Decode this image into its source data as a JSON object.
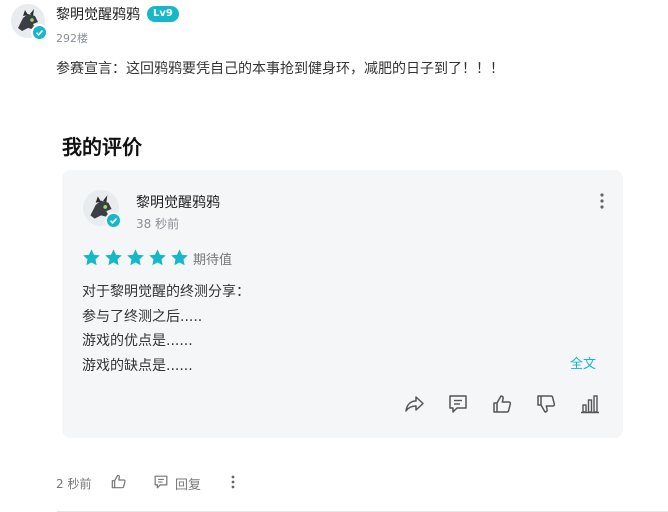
{
  "post": {
    "author_name": "黎明觉醒鸦鸦",
    "level": "Lv9",
    "floor": "292楼",
    "content": "参赛宣言：这回鸦鸦要凭自己的本事抢到健身环，减肥的日子到了！！！"
  },
  "review_section": {
    "title": "我的评价",
    "card": {
      "author_name": "黎明觉醒鸦鸦",
      "time": "38 秒前",
      "rating": 5,
      "rating_max": 5,
      "rating_label": "期待值",
      "lines": [
        "对于黎明觉醒的终测分享：",
        "参与了终测之后.....",
        "游戏的优点是......",
        "游戏的缺点是......"
      ],
      "full_text_label": "全文"
    }
  },
  "footer": {
    "time": "2 秒前",
    "reply_label": "回复"
  },
  "colors": {
    "accent": "#15b8c9",
    "card_bg": "#f5f6f7",
    "muted_text": "#8a8f96"
  }
}
